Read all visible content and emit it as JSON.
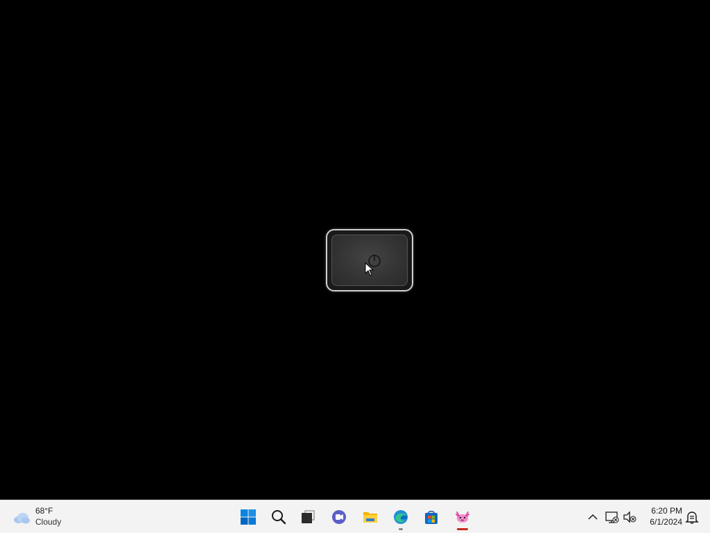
{
  "desktop": {
    "background_color": "#000000",
    "center_window": {
      "icon": "power-icon"
    }
  },
  "taskbar": {
    "background_color": "#f3f3f3",
    "weather": {
      "temperature": "68°F",
      "condition": "Cloudy",
      "icon": "cloud-icon"
    },
    "pinned": [
      {
        "name": "start-button",
        "icon": "windows-logo-icon"
      },
      {
        "name": "search-button",
        "icon": "search-icon"
      },
      {
        "name": "task-view-button",
        "icon": "task-view-icon"
      },
      {
        "name": "chat-button",
        "icon": "chat-icon"
      },
      {
        "name": "file-explorer-button",
        "icon": "folder-icon"
      },
      {
        "name": "edge-button",
        "icon": "edge-icon"
      },
      {
        "name": "store-button",
        "icon": "store-icon"
      },
      {
        "name": "app-button",
        "icon": "axolotl-icon"
      }
    ],
    "tray": {
      "icons": [
        "chevron-up-icon",
        "network-icon",
        "volume-muted-icon",
        "notification-icon"
      ]
    },
    "clock": {
      "time": "6:20 PM",
      "date": "6/1/2024"
    },
    "accent_active": "#c42b1c",
    "windows_blue": "#0078d4"
  }
}
